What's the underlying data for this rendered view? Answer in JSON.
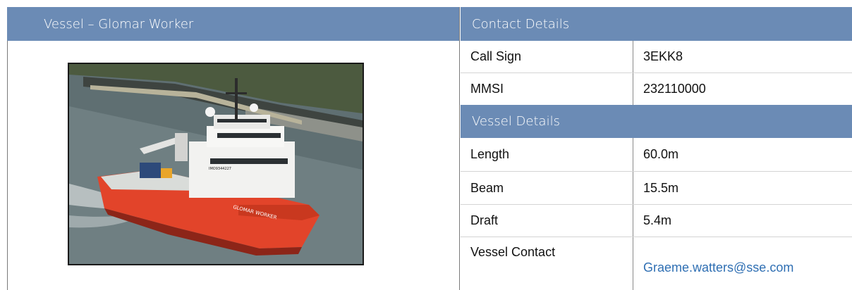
{
  "left_panel": {
    "title": "Vessel – Glomar Worker"
  },
  "contact_details": {
    "title": "Contact Details",
    "rows": [
      {
        "label": "Call Sign",
        "value": "3EKK8"
      },
      {
        "label": "MMSI",
        "value": "232110000"
      }
    ]
  },
  "vessel_details": {
    "title": "Vessel Details",
    "rows": [
      {
        "label": "Length",
        "value": "60.0m"
      },
      {
        "label": "Beam",
        "value": "15.5m"
      },
      {
        "label": "Draft",
        "value": "5.4m"
      }
    ],
    "contact": {
      "label": "Vessel Contact",
      "value": "Graeme.watters@sse.com"
    }
  },
  "photo": {
    "hull_name": "GLOMAR WORKER",
    "imo_marking": "IMO9344227"
  },
  "colors": {
    "header_bg": "#6b8bb5",
    "header_text": "#ffffff",
    "link": "#2f6fb3",
    "hull": "#e2442a"
  }
}
